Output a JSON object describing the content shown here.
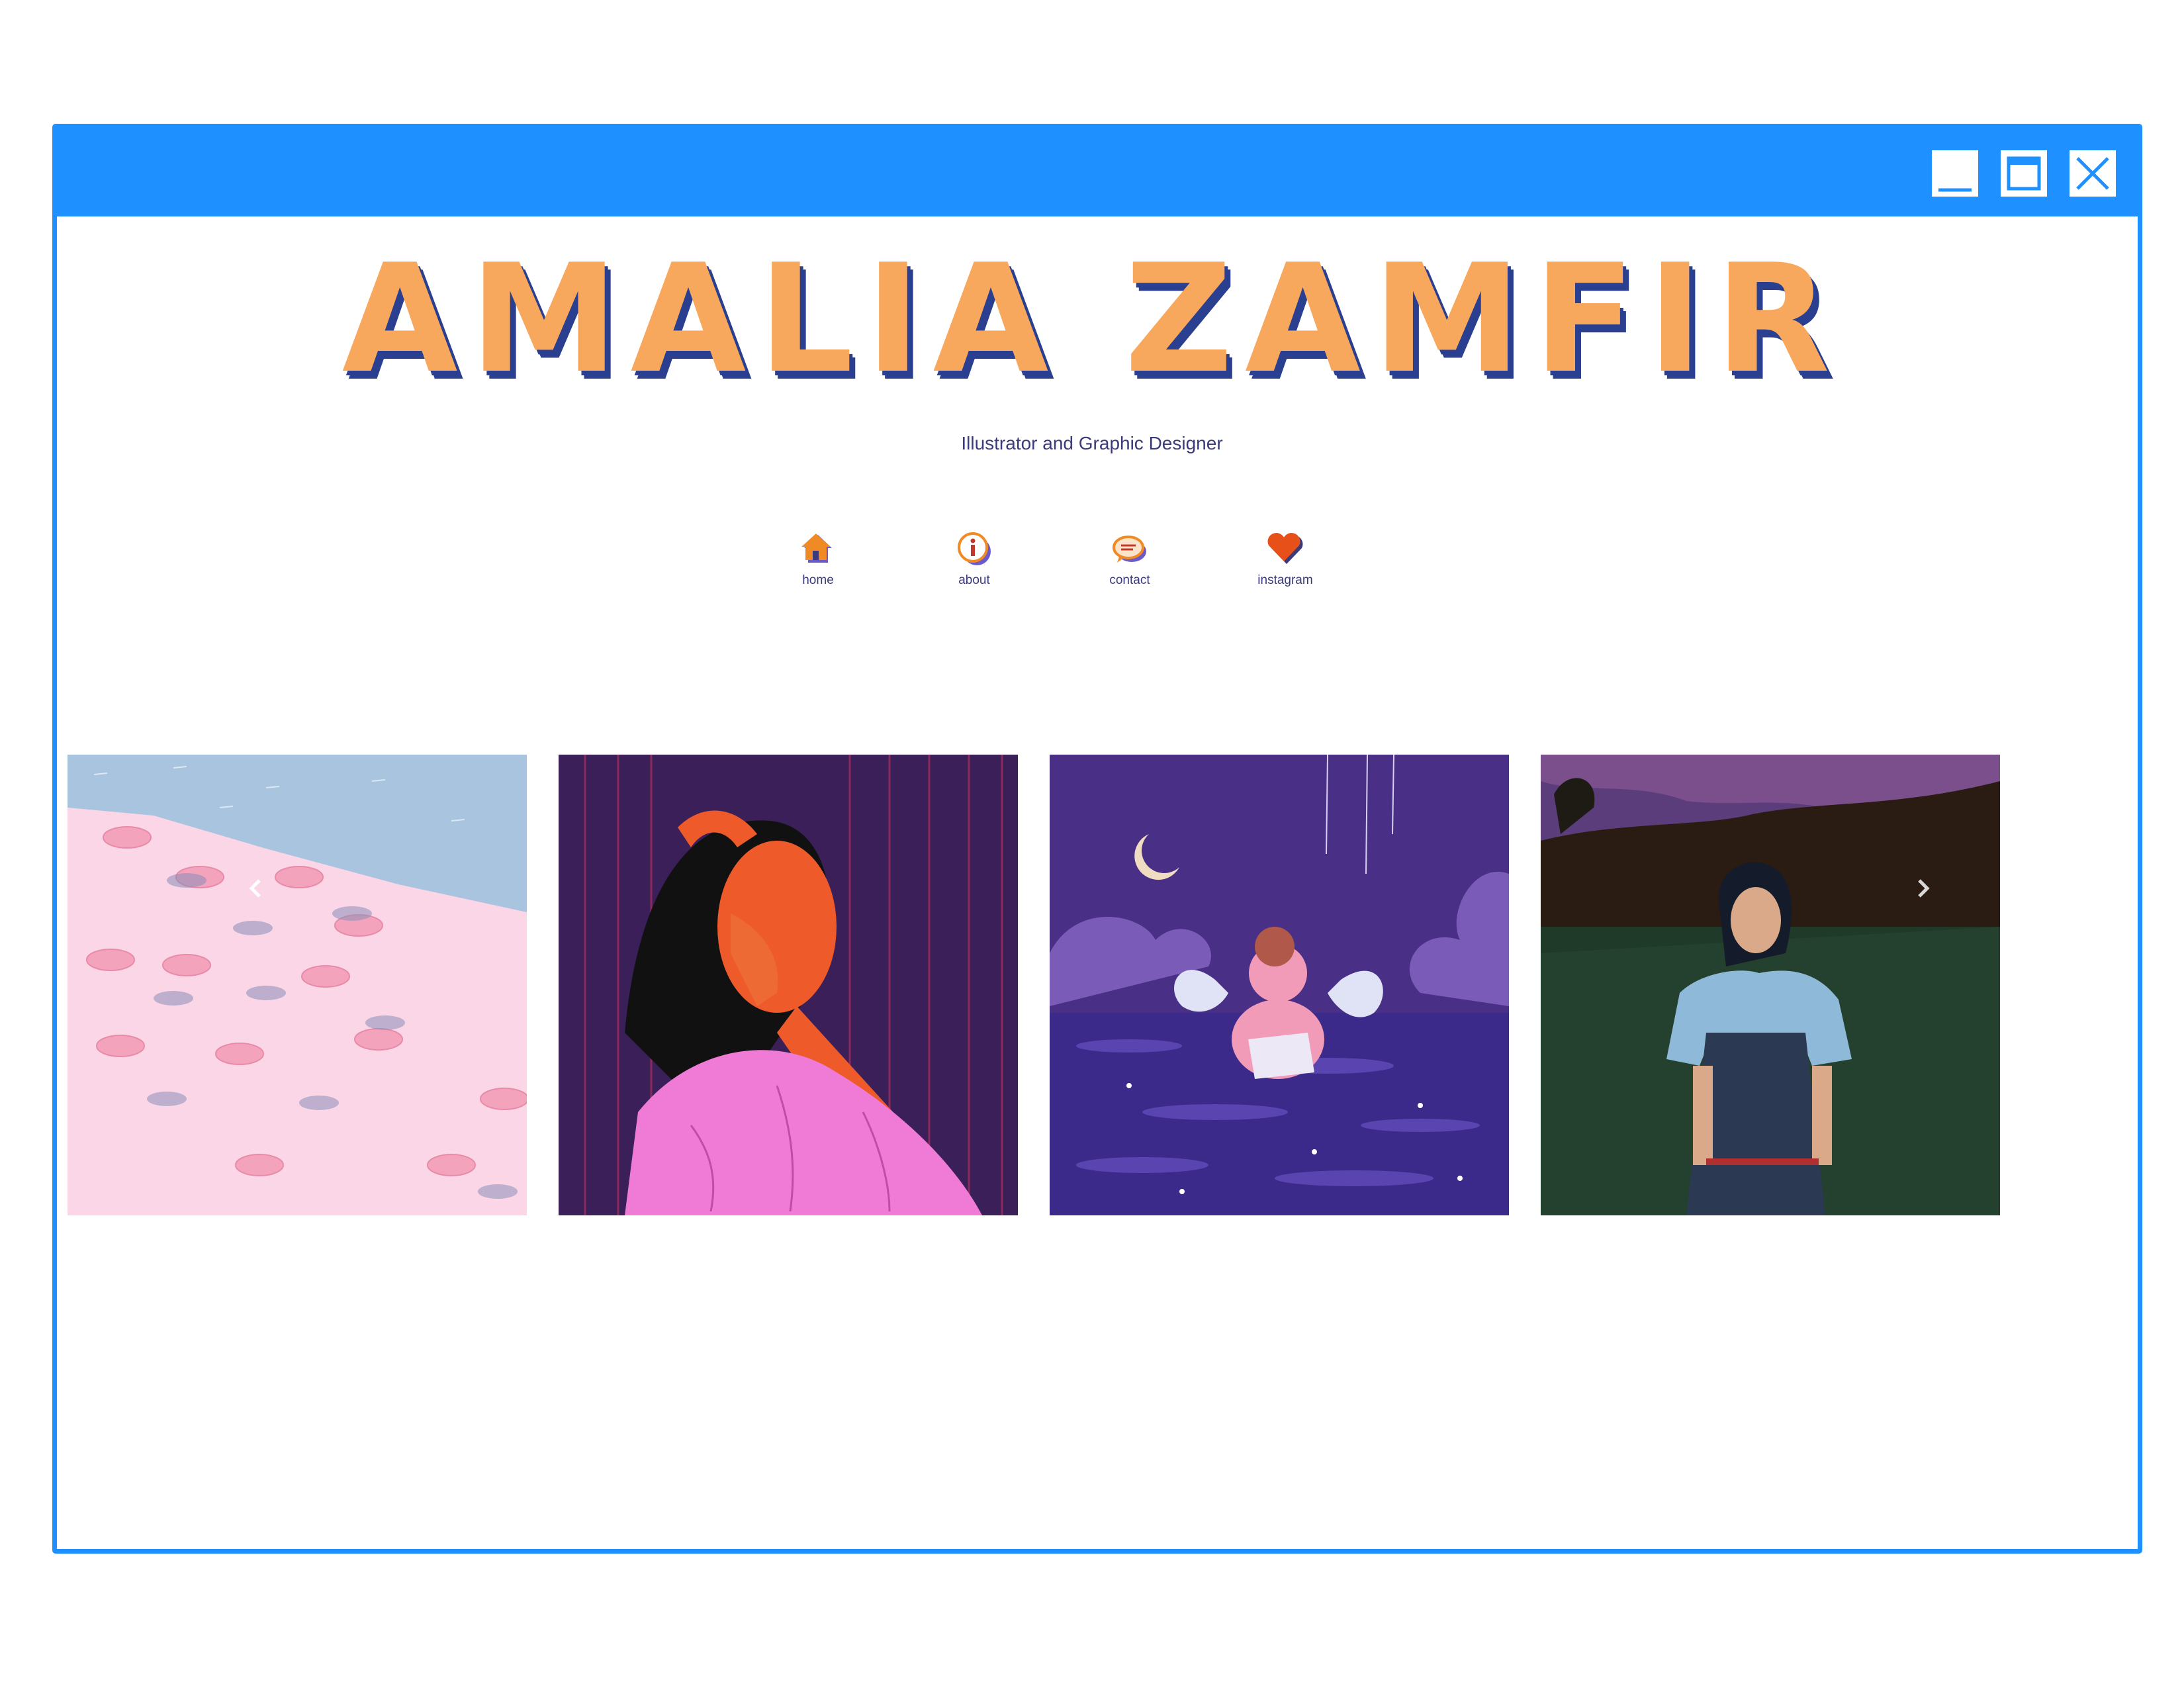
{
  "site": {
    "title": "AMALIA ZAMFIR",
    "subtitle": "Illustrator and Graphic Designer"
  },
  "nav": {
    "items": [
      {
        "label": "home",
        "icon": "house-icon"
      },
      {
        "label": "about",
        "icon": "info-icon"
      },
      {
        "label": "contact",
        "icon": "chat-icon"
      },
      {
        "label": "instagram",
        "icon": "heart-icon"
      }
    ]
  },
  "gallery": {
    "items": [
      {
        "subject": "pink beach umbrellas"
      },
      {
        "subject": "woman with hand on face"
      },
      {
        "subject": "cherub in purple sea"
      },
      {
        "subject": "woman in blue shirt at night"
      }
    ],
    "prev_icon": "chevron-left-icon",
    "next_icon": "chevron-right-icon"
  },
  "colors": {
    "window_frame": "#1e90ff",
    "title_fill": "#f7a85c",
    "title_shadow": "#2a3f8f",
    "text": "#3b3a7a"
  }
}
